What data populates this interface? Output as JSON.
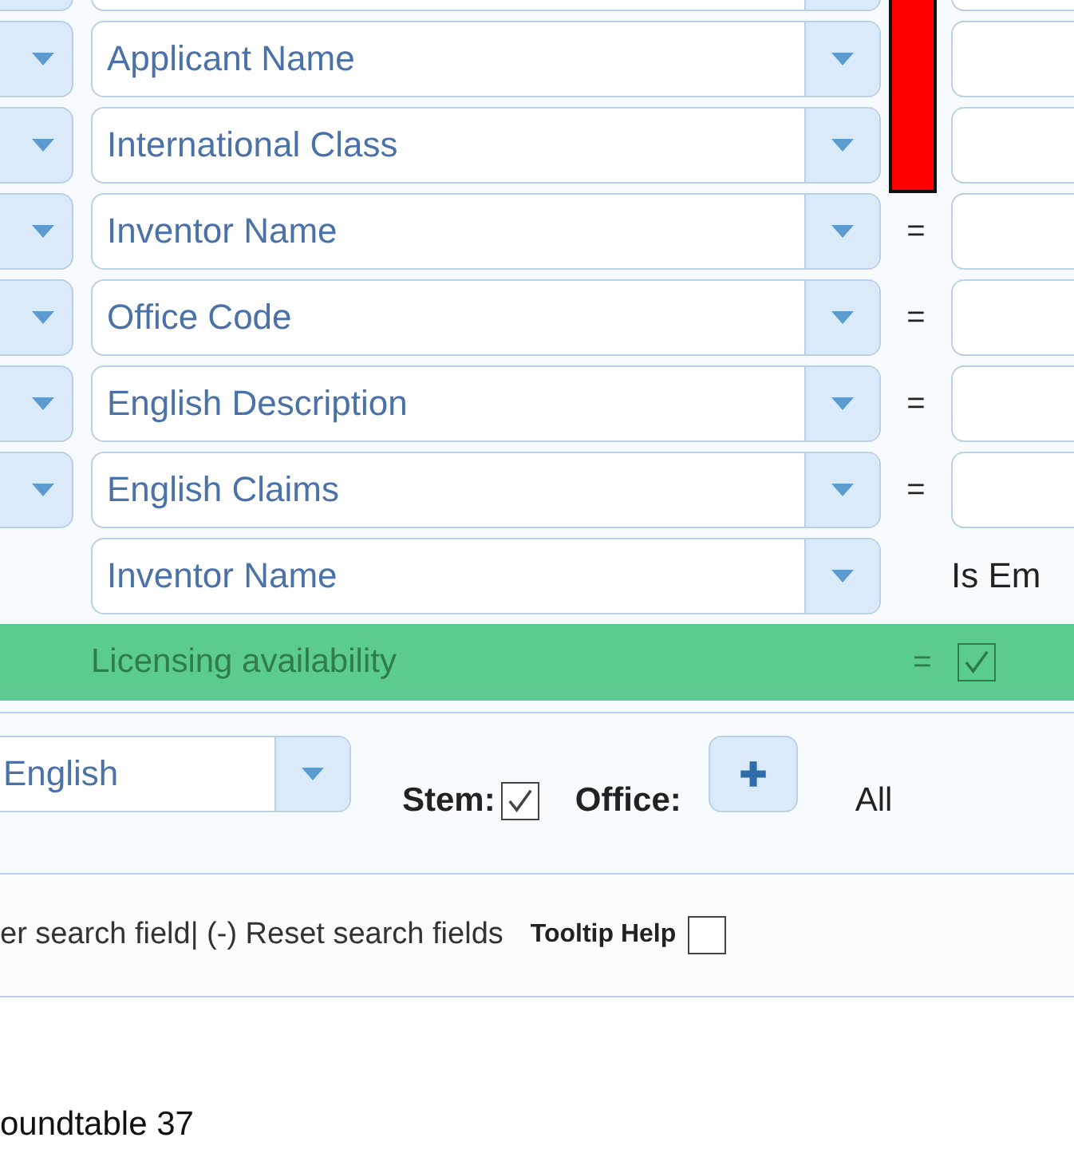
{
  "rows": [
    {
      "kind": "criterion"
    },
    {
      "kind": "criterion",
      "field": "Applicant Name"
    },
    {
      "kind": "criterion",
      "field": "International Class"
    },
    {
      "kind": "criterion",
      "field": "Inventor Name",
      "operator": "="
    },
    {
      "kind": "criterion",
      "field": "Office Code",
      "operator": "="
    },
    {
      "kind": "criterion",
      "field": "English Description",
      "operator": "="
    },
    {
      "kind": "criterion",
      "field": "English Claims",
      "operator": "="
    },
    {
      "kind": "condition",
      "field": "Inventor Name",
      "condition": "Is Em"
    }
  ],
  "highlighted_row": {
    "label": "Licensing availability",
    "operator": "=",
    "checked": true
  },
  "options": {
    "language": "English",
    "stem_label": "Stem:",
    "stem_checked": true,
    "office_label": "Office:",
    "office_value": "All"
  },
  "help_bar": {
    "text": "er search field| (-) Reset search fields",
    "tooltip_label": "Tooltip Help",
    "tooltip_checked": false
  },
  "footer": "oundtable 37"
}
